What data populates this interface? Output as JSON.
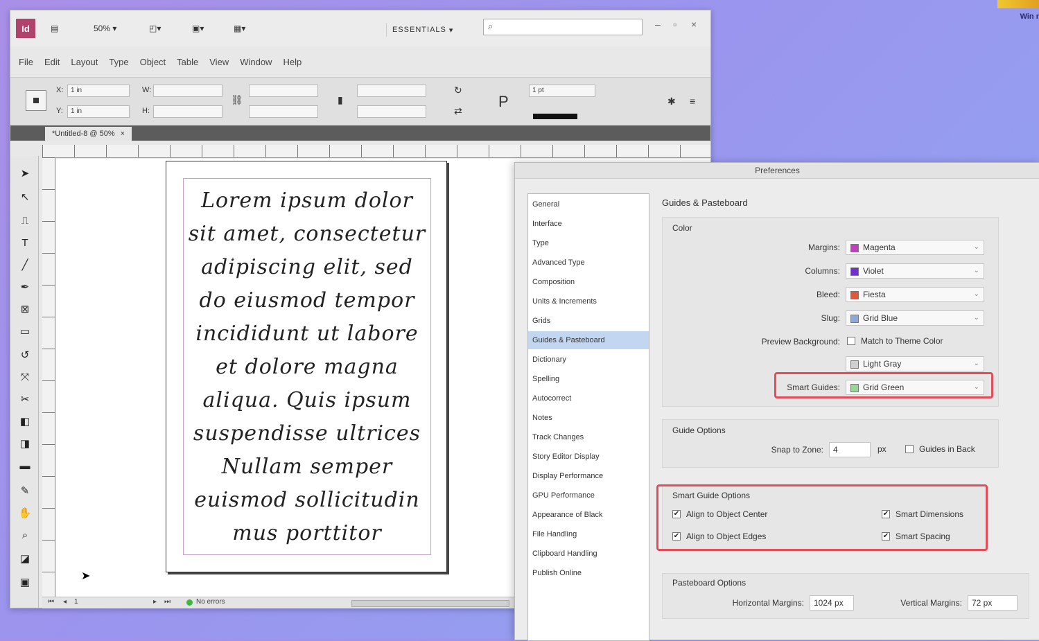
{
  "desktop": {
    "corner_text": "Win r"
  },
  "app": {
    "logo": "Id",
    "zoom": "50%",
    "workspace": "ESSENTIALS",
    "menu": [
      "File",
      "Edit",
      "Layout",
      "Type",
      "Object",
      "Table",
      "View",
      "Window",
      "Help"
    ],
    "control_panel": {
      "x_label": "X:",
      "y_label": "Y:",
      "x_value": "1 in",
      "y_value": "1 in",
      "w_label": "W:",
      "h_label": "H:",
      "stroke_weight": "1 pt"
    },
    "doc_tab": "*Untitled-8 @ 50%",
    "doc_text": [
      "Lorem ipsum dolor",
      "sit amet, consectetur",
      "adipiscing elit, sed",
      "do eiusmod tempor",
      "incididunt ut labore",
      "et dolore magna",
      "aliqua. Quis ipsum",
      "suspendisse ultrices",
      "Nullam semper",
      "euismod sollicitudin",
      "mus porttitor"
    ],
    "status": {
      "page": "1",
      "preflight": "No errors"
    }
  },
  "prefs": {
    "title": "Preferences",
    "categories": [
      "General",
      "Interface",
      "Type",
      "Advanced Type",
      "Composition",
      "Units & Increments",
      "Grids",
      "Guides & Pasteboard",
      "Dictionary",
      "Spelling",
      "Autocorrect",
      "Notes",
      "Track Changes",
      "Story Editor Display",
      "Display Performance",
      "GPU Performance",
      "Appearance of Black",
      "File Handling",
      "Clipboard Handling",
      "Publish Online"
    ],
    "selected_category": "Guides & Pasteboard",
    "section_title": "Guides & Pasteboard",
    "color_group": {
      "title": "Color",
      "margins_label": "Margins:",
      "margins_value": "Magenta",
      "margins_color": "#c040c0",
      "columns_label": "Columns:",
      "columns_value": "Violet",
      "columns_color": "#7030d0",
      "bleed_label": "Bleed:",
      "bleed_value": "Fiesta",
      "bleed_color": "#e05a3a",
      "slug_label": "Slug:",
      "slug_value": "Grid Blue",
      "slug_color": "#8fa8d8",
      "preview_label": "Preview Background:",
      "preview_check_label": "Match to Theme Color",
      "preview_value": "Light Gray",
      "preview_color": "#cfcfcf",
      "smart_label": "Smart Guides:",
      "smart_value": "Grid Green",
      "smart_color": "#9ad69a"
    },
    "guide_options": {
      "title": "Guide Options",
      "snap_label": "Snap to Zone:",
      "snap_value": "4",
      "snap_unit": "px",
      "guides_back": "Guides in Back"
    },
    "smart_guide_options": {
      "title": "Smart Guide Options",
      "align_center": "Align to Object Center",
      "align_edges": "Align to Object Edges",
      "smart_dimensions": "Smart Dimensions",
      "smart_spacing": "Smart Spacing"
    },
    "pasteboard_options": {
      "title": "Pasteboard Options",
      "h_label": "Horizontal Margins:",
      "h_value": "1024 px",
      "v_label": "Vertical Margins:",
      "v_value": "72 px"
    }
  }
}
